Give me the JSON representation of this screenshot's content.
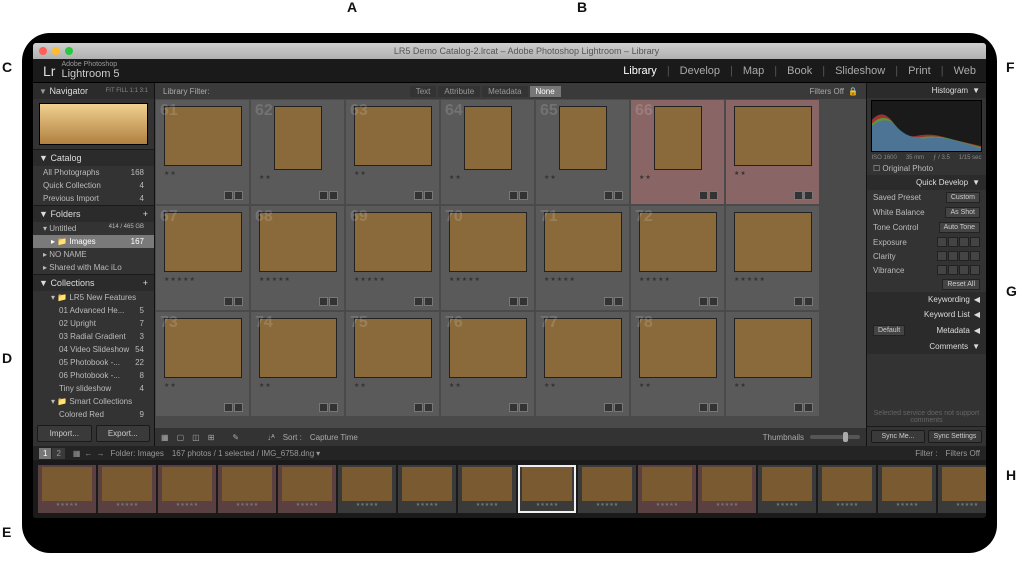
{
  "callouts": {
    "A": "A",
    "B": "B",
    "C": "C",
    "D": "D",
    "E": "E",
    "F": "F",
    "G": "G",
    "H": "H"
  },
  "titlebar": {
    "title": "LR5 Demo Catalog-2.lrcat – Adobe Photoshop Lightroom – Library"
  },
  "brand": {
    "lr": "Lr",
    "adobe": "Adobe Photoshop",
    "name": "Lightroom 5"
  },
  "modules": {
    "library": "Library",
    "develop": "Develop",
    "map": "Map",
    "book": "Book",
    "slideshow": "Slideshow",
    "print": "Print",
    "web": "Web"
  },
  "left": {
    "navigator": {
      "label": "Navigator",
      "opts": "FIT  FILL  1:1  3:1"
    },
    "catalog": {
      "label": "Catalog",
      "items": [
        {
          "label": "All Photographs",
          "count": "168"
        },
        {
          "label": "Quick Collection",
          "count": "4"
        },
        {
          "label": "Previous Import",
          "count": "4"
        }
      ]
    },
    "folders": {
      "label": "Folders",
      "volume": {
        "label": "Untitled",
        "meta": "414 / 465 GB"
      },
      "images": {
        "label": "Images",
        "count": "167"
      },
      "noname": {
        "label": "NO NAME"
      },
      "shared": {
        "label": "Shared with Mac iLo"
      }
    },
    "collections": {
      "label": "Collections",
      "set": "LR5 New Features",
      "items": [
        {
          "label": "01 Advanced He...",
          "count": "5"
        },
        {
          "label": "02 Upright",
          "count": "7"
        },
        {
          "label": "03 Radial Gradient",
          "count": "3"
        },
        {
          "label": "04 Video Slideshow",
          "count": "54"
        },
        {
          "label": "05 Photobook -...",
          "count": "22"
        },
        {
          "label": "06 Photobook -...",
          "count": "8"
        },
        {
          "label": "Tiny slideshow",
          "count": "4"
        }
      ],
      "smart": {
        "label": "Smart Collections"
      },
      "colored": {
        "label": "Colored Red",
        "count": "9"
      }
    },
    "buttons": {
      "import": "Import...",
      "export": "Export..."
    }
  },
  "filterbar": {
    "label": "Library Filter:",
    "text": "Text",
    "attribute": "Attribute",
    "metadata": "Metadata",
    "none": "None",
    "right": "Filters Off"
  },
  "toolbar": {
    "sort_label": "Sort :",
    "sort_value": "Capture Time",
    "thumbnails": "Thumbnails"
  },
  "right": {
    "histogram": {
      "label": "Histogram",
      "iso": "ISO 1600",
      "focal": "35 mm",
      "fstop": "ƒ / 3.5",
      "shutter": "1/15 sec"
    },
    "original_photo": "Original Photo",
    "quick_develop": {
      "label": "Quick Develop",
      "preset_label": "Saved Preset",
      "preset_value": "Custom",
      "wb_label": "White Balance",
      "wb_value": "As Shot",
      "tone_label": "Tone Control",
      "tone_value": "Auto Tone",
      "exposure": "Exposure",
      "clarity": "Clarity",
      "vibrance": "Vibrance",
      "reset": "Reset All"
    },
    "keywording": "Keywording",
    "keyword_list": "Keyword List",
    "metadata": {
      "label": "Metadata",
      "preset": "Default"
    },
    "comments": {
      "label": "Comments",
      "note": "Selected service does not support comments"
    },
    "sync_meta": "Sync Me...",
    "sync_settings": "Sync Settings"
  },
  "status": {
    "seg1": "1",
    "seg2": "2",
    "folder_label": "Folder: Images",
    "summary": "167 photos / 1 selected / IMG_6758.dng",
    "filter": "Filter :",
    "filters_off": "Filters Off"
  },
  "grid": {
    "row1": [
      {
        "n": "61",
        "orient": "l",
        "pink": false
      },
      {
        "n": "62",
        "orient": "p",
        "pink": false
      },
      {
        "n": "63",
        "orient": "l",
        "pink": false
      },
      {
        "n": "64",
        "orient": "p",
        "pink": false
      },
      {
        "n": "65",
        "orient": "p",
        "pink": false
      },
      {
        "n": "66",
        "orient": "p",
        "pink": true
      },
      {
        "n": "",
        "orient": "l",
        "pink": true
      }
    ],
    "row2": [
      {
        "n": "67",
        "orient": "l"
      },
      {
        "n": "68",
        "orient": "l"
      },
      {
        "n": "69",
        "orient": "l"
      },
      {
        "n": "70",
        "orient": "l"
      },
      {
        "n": "71",
        "orient": "l"
      },
      {
        "n": "72",
        "orient": "l"
      },
      {
        "n": "",
        "orient": "l"
      }
    ],
    "row3": [
      {
        "n": "73",
        "orient": "l"
      },
      {
        "n": "74",
        "orient": "l"
      },
      {
        "n": "75",
        "orient": "l"
      },
      {
        "n": "76",
        "orient": "l"
      },
      {
        "n": "77",
        "orient": "l"
      },
      {
        "n": "78",
        "orient": "l"
      },
      {
        "n": "",
        "orient": "l"
      }
    ]
  },
  "stars5": "★★★★★",
  "stars2": "★★"
}
